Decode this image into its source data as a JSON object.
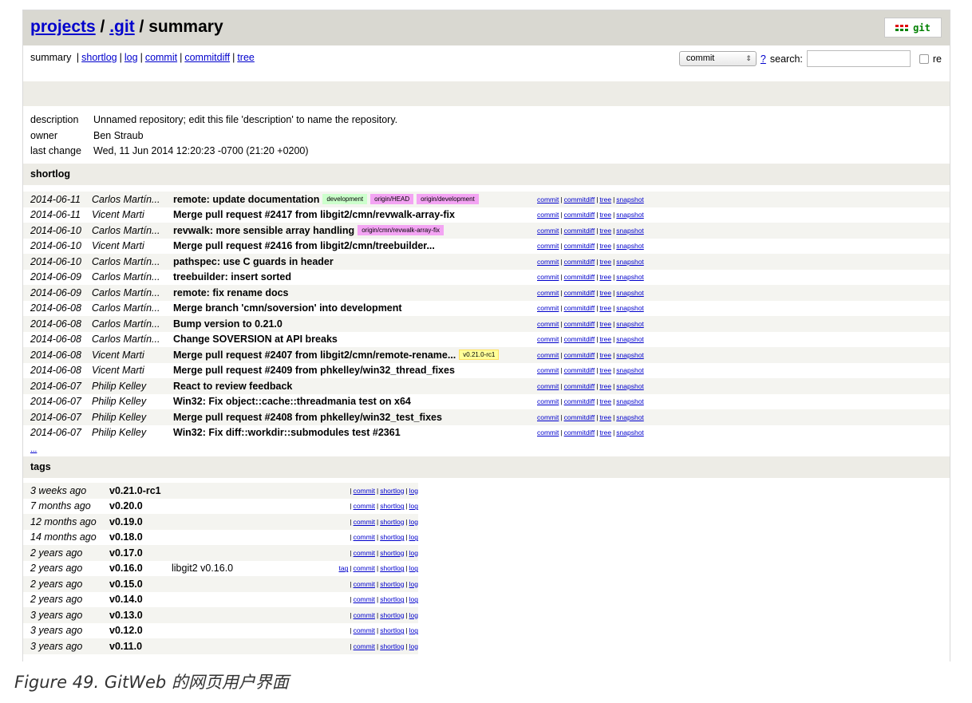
{
  "header": {
    "breadcrumb_projects": "projects",
    "breadcrumb_sep1": " / ",
    "breadcrumb_repo": ".git",
    "breadcrumb_sep2": " / ",
    "breadcrumb_page": "summary",
    "logo_text": "git"
  },
  "nav": {
    "current": "summary",
    "links": [
      "shortlog",
      "log",
      "commit",
      "commitdiff",
      "tree"
    ],
    "search_select": "commit",
    "help_link": "?",
    "search_label": "search:",
    "search_value": "",
    "regex_label": "re"
  },
  "project_info": [
    {
      "key": "description",
      "value": "Unnamed repository; edit this file 'description' to name the repository."
    },
    {
      "key": "owner",
      "value": "Ben Straub"
    },
    {
      "key": "last change",
      "value": "Wed, 11 Jun 2014 12:20:23 -0700 (21:20 +0200)"
    }
  ],
  "shortlog": {
    "title": "shortlog",
    "row_links": [
      "commit",
      "commitdiff",
      "tree",
      "snapshot"
    ],
    "rows": [
      {
        "date": "2014-06-11",
        "author": "Carlos Martín...",
        "subject": "remote: update documentation",
        "refs": [
          {
            "label": "development",
            "kind": "head"
          },
          {
            "label": "origin/HEAD",
            "kind": "remote"
          },
          {
            "label": "origin/development",
            "kind": "remote"
          }
        ]
      },
      {
        "date": "2014-06-11",
        "author": "Vicent Marti",
        "subject": "Merge pull request #2417 from libgit2/cmn/revwalk-array-fix",
        "refs": []
      },
      {
        "date": "2014-06-10",
        "author": "Carlos Martín...",
        "subject": "revwalk: more sensible array handling",
        "refs": [
          {
            "label": "origin/cmn/revwalk-array-fix",
            "kind": "remote"
          }
        ]
      },
      {
        "date": "2014-06-10",
        "author": "Vicent Marti",
        "subject": "Merge pull request #2416 from libgit2/cmn/treebuilder...",
        "refs": []
      },
      {
        "date": "2014-06-10",
        "author": "Carlos Martín...",
        "subject": "pathspec: use C guards in header",
        "refs": []
      },
      {
        "date": "2014-06-09",
        "author": "Carlos Martín...",
        "subject": "treebuilder: insert sorted",
        "refs": []
      },
      {
        "date": "2014-06-09",
        "author": "Carlos Martín...",
        "subject": "remote: fix rename docs",
        "refs": []
      },
      {
        "date": "2014-06-08",
        "author": "Carlos Martín...",
        "subject": "Merge branch 'cmn/soversion' into development",
        "refs": []
      },
      {
        "date": "2014-06-08",
        "author": "Carlos Martín...",
        "subject": "Bump version to 0.21.0",
        "refs": []
      },
      {
        "date": "2014-06-08",
        "author": "Carlos Martín...",
        "subject": "Change SOVERSION at API breaks",
        "refs": []
      },
      {
        "date": "2014-06-08",
        "author": "Vicent Marti",
        "subject": "Merge pull request #2407 from libgit2/cmn/remote-rename...",
        "refs": [
          {
            "label": "v0.21.0-rc1",
            "kind": "tag"
          }
        ]
      },
      {
        "date": "2014-06-08",
        "author": "Vicent Marti",
        "subject": "Merge pull request #2409 from phkelley/win32_thread_fixes",
        "refs": []
      },
      {
        "date": "2014-06-07",
        "author": "Philip Kelley",
        "subject": "React to review feedback",
        "refs": []
      },
      {
        "date": "2014-06-07",
        "author": "Philip Kelley",
        "subject": "Win32: Fix object::cache::threadmania test on x64",
        "refs": []
      },
      {
        "date": "2014-06-07",
        "author": "Philip Kelley",
        "subject": "Merge pull request #2408 from phkelley/win32_test_fixes",
        "refs": []
      },
      {
        "date": "2014-06-07",
        "author": "Philip Kelley",
        "subject": "Win32: Fix diff::workdir::submodules test #2361",
        "refs": []
      }
    ],
    "more": "..."
  },
  "tags": {
    "title": "tags",
    "row_links": [
      "commit",
      "shortlog",
      "log"
    ],
    "tag_link": "tag",
    "rows": [
      {
        "age": "3 weeks ago",
        "name": "v0.21.0-rc1",
        "desc": "",
        "has_tag": false
      },
      {
        "age": "7 months ago",
        "name": "v0.20.0",
        "desc": "",
        "has_tag": false
      },
      {
        "age": "12 months ago",
        "name": "v0.19.0",
        "desc": "",
        "has_tag": false
      },
      {
        "age": "14 months ago",
        "name": "v0.18.0",
        "desc": "",
        "has_tag": false
      },
      {
        "age": "2 years ago",
        "name": "v0.17.0",
        "desc": "",
        "has_tag": false
      },
      {
        "age": "2 years ago",
        "name": "v0.16.0",
        "desc": "libgit2 v0.16.0",
        "has_tag": true
      },
      {
        "age": "2 years ago",
        "name": "v0.15.0",
        "desc": "",
        "has_tag": false
      },
      {
        "age": "2 years ago",
        "name": "v0.14.0",
        "desc": "",
        "has_tag": false
      },
      {
        "age": "3 years ago",
        "name": "v0.13.0",
        "desc": "",
        "has_tag": false
      },
      {
        "age": "3 years ago",
        "name": "v0.12.0",
        "desc": "",
        "has_tag": false
      },
      {
        "age": "3 years ago",
        "name": "v0.11.0",
        "desc": "",
        "has_tag": false
      }
    ]
  },
  "caption": "Figure 49. GitWeb 的网页用户界面",
  "colors": {
    "header_bg": "#d9d8d1",
    "section_bg": "#edece6",
    "link": "#0000cc",
    "ref_head": "#ccffcc",
    "ref_remote": "#f3a4f3",
    "ref_tag": "#ffff99",
    "logo_red": "#e00000",
    "logo_green": "#008000"
  }
}
